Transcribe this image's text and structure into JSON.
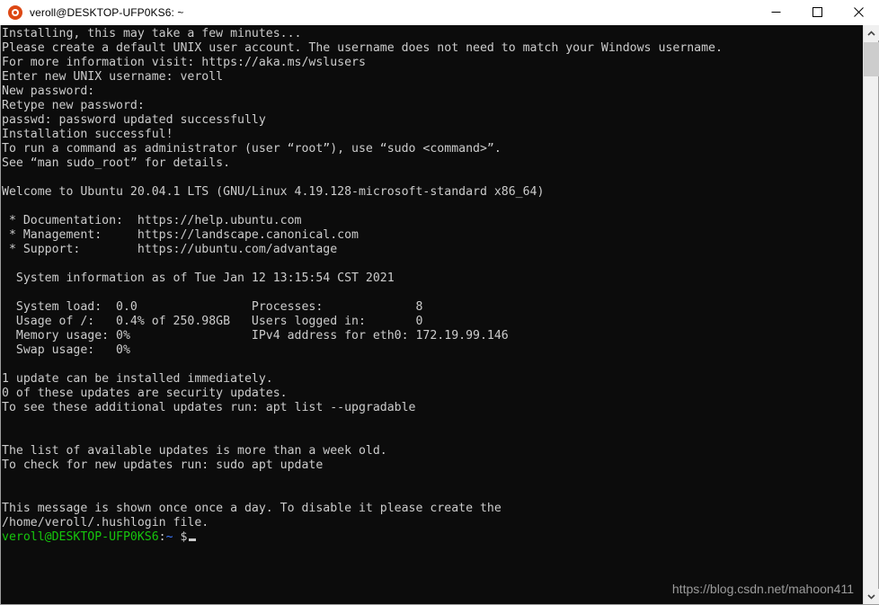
{
  "window": {
    "title": "veroll@DESKTOP-UFP0KS6: ~",
    "app_icon": "ubuntu-logo-icon",
    "controls": {
      "minimize": "minimize-icon",
      "maximize": "maximize-icon",
      "close": "close-icon"
    }
  },
  "terminal": {
    "background_color": "#0c0c0c",
    "foreground_color": "#cccccc",
    "prompt_user_color": "#16c60c",
    "prompt_path_color": "#3b78ff",
    "lines": [
      "Installing, this may take a few minutes...",
      "Please create a default UNIX user account. The username does not need to match your Windows username.",
      "For more information visit: https://aka.ms/wslusers",
      "Enter new UNIX username: veroll",
      "New password:",
      "Retype new password:",
      "passwd: password updated successfully",
      "Installation successful!",
      "To run a command as administrator (user “root”), use “sudo <command>”.",
      "See “man sudo_root” for details.",
      "",
      "Welcome to Ubuntu 20.04.1 LTS (GNU/Linux 4.19.128-microsoft-standard x86_64)",
      "",
      " * Documentation:  https://help.ubuntu.com",
      " * Management:     https://landscape.canonical.com",
      " * Support:        https://ubuntu.com/advantage",
      "",
      "  System information as of Tue Jan 12 13:15:54 CST 2021",
      "",
      "  System load:  0.0                Processes:             8",
      "  Usage of /:   0.4% of 250.98GB   Users logged in:       0",
      "  Memory usage: 0%                 IPv4 address for eth0: 172.19.99.146",
      "  Swap usage:   0%",
      "",
      "1 update can be installed immediately.",
      "0 of these updates are security updates.",
      "To see these additional updates run: apt list --upgradable",
      "",
      "",
      "The list of available updates is more than a week old.",
      "To check for new updates run: sudo apt update",
      "",
      "",
      "This message is shown once once a day. To disable it please create the",
      "/home/veroll/.hushlogin file."
    ],
    "prompt": {
      "user_host": "veroll@DESKTOP-UFP0KS6",
      "separator": ":",
      "path": "~",
      "symbol": "$",
      "cursor": "block-cursor"
    }
  },
  "system_info": {
    "heading": "System information as of Tue Jan 12 13:15:54 CST 2021",
    "left_column": [
      {
        "label": "System load:",
        "value": "0.0"
      },
      {
        "label": "Usage of /:",
        "value": "0.4% of 250.98GB"
      },
      {
        "label": "Memory usage:",
        "value": "0%"
      },
      {
        "label": "Swap usage:",
        "value": "0%"
      }
    ],
    "right_column": [
      {
        "label": "Processes:",
        "value": "8"
      },
      {
        "label": "Users logged in:",
        "value": "0"
      },
      {
        "label": "IPv4 address for eth0:",
        "value": "172.19.99.146"
      }
    ]
  },
  "links": [
    {
      "label": "Documentation:",
      "url": "https://help.ubuntu.com"
    },
    {
      "label": "Management:",
      "url": "https://landscape.canonical.com"
    },
    {
      "label": "Support:",
      "url": "https://ubuntu.com/advantage"
    }
  ],
  "watermark": {
    "text": "https://blog.csdn.net/mahoon411"
  },
  "scrollbar": {
    "up_arrow": "chevron-up-icon",
    "down_arrow": "chevron-down-icon"
  }
}
